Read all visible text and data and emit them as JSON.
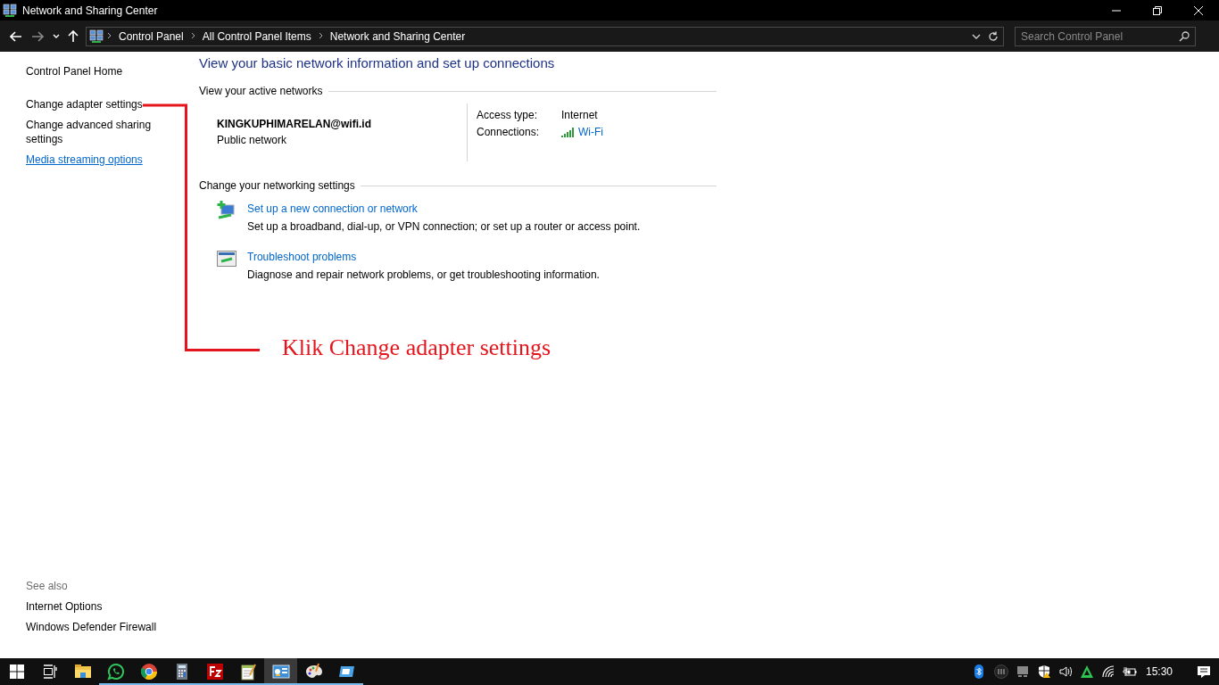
{
  "window": {
    "title": "Network and Sharing Center"
  },
  "address_bar": {
    "breadcrumbs": [
      "Control Panel",
      "All Control Panel Items",
      "Network and Sharing Center"
    ]
  },
  "search": {
    "placeholder": "Search Control Panel"
  },
  "sidebar": {
    "items": [
      {
        "label": "Control Panel Home",
        "kind": "home"
      },
      {
        "label": "Change adapter settings",
        "kind": "task"
      },
      {
        "label": "Change advanced sharing settings",
        "kind": "task"
      },
      {
        "label": "Media streaming options",
        "kind": "link"
      }
    ],
    "see_also_heading": "See also",
    "see_also": [
      "Internet Options",
      "Windows Defender Firewall"
    ]
  },
  "main": {
    "heading": "View your basic network information and set up connections",
    "active_networks": {
      "title": "View your active networks",
      "name": "KINGKUPHIMARELAN@wifi.id",
      "category": "Public network",
      "access_type_label": "Access type:",
      "access_type": "Internet",
      "connections_label": "Connections:",
      "connection": "Wi-Fi"
    },
    "settings": {
      "title": "Change your networking settings",
      "tasks": [
        {
          "kind": "new-connection",
          "link": "Set up a new connection or network",
          "description": "Set up a broadband, dial-up, or VPN connection; or set up a router or access point."
        },
        {
          "kind": "troubleshoot",
          "link": "Troubleshoot problems",
          "description": "Diagnose and repair network problems, or get troubleshooting information."
        }
      ]
    }
  },
  "annotation": {
    "text": "Klik Change adapter settings"
  },
  "taskbar": {
    "apps": [
      {
        "kind": "explorer",
        "running": false,
        "selected": false
      },
      {
        "kind": "chat",
        "running": true,
        "selected": false
      },
      {
        "kind": "browser",
        "running": true,
        "selected": false
      },
      {
        "kind": "calculator",
        "running": true,
        "selected": false
      },
      {
        "kind": "ftp",
        "running": true,
        "selected": false
      },
      {
        "kind": "notepad",
        "running": true,
        "selected": false
      },
      {
        "kind": "control-panel",
        "running": true,
        "selected": true
      },
      {
        "kind": "paint",
        "running": true,
        "selected": false
      },
      {
        "kind": "screen",
        "running": true,
        "selected": false
      }
    ],
    "clock": "15:30"
  }
}
